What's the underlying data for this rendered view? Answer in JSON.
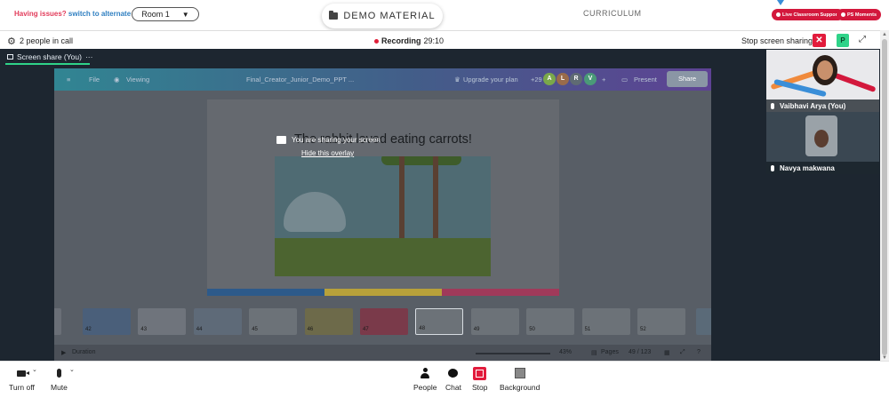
{
  "topbar": {
    "issues_label": "Having issues?",
    "switch_label": "switch to alternate room",
    "room_value": "Room 1",
    "demo_material_label": "DEMO MATERIAL",
    "curriculum_label": "CURRICULUM",
    "live_support_label": "Live Classroom Support",
    "ps_moments_label": "PS Moments",
    "colors": {
      "pill": "#d3183c",
      "issues": "#e23b5a",
      "switch": "#2f7fc1"
    }
  },
  "callbar": {
    "people_in_call": "2 people in call",
    "recording_label": "Recording",
    "recording_time": "29:10",
    "stop_screen_sharing": "Stop screen sharing",
    "close_glyph": "✕",
    "participant_badge": "P",
    "expand_glyph": "⤢"
  },
  "stage": {
    "tab_label": "Screen share (You)",
    "tab_more": "···"
  },
  "shared_screen": {
    "toolbar": {
      "file_label": "File",
      "viewing_label": "Viewing",
      "doc_title": "Final_Creator_Junior_Demo_PPT ...",
      "upgrade_label": "Upgrade your plan",
      "plus_count": "+29",
      "avatars": [
        {
          "letter": "A",
          "color": "#7aa84a"
        },
        {
          "letter": "L",
          "color": "#9a6b4a"
        },
        {
          "letter": "R",
          "color": "#5f6b73"
        },
        {
          "letter": "V",
          "color": "#4a9a78"
        }
      ],
      "add_glyph": "+",
      "present_label": "Present",
      "share_label": "Share"
    },
    "slide": {
      "title": "The rabbit loved eating carrots!",
      "bar_colors": [
        "#2d5a8a",
        "#b8a13a",
        "#a03a5a"
      ]
    },
    "overlay": {
      "message": "You are sharing your screen",
      "hide_link": "Hide this overlay"
    },
    "thumbnails": [
      {
        "num": "",
        "color": "#6a6f77"
      },
      {
        "num": "42",
        "color": "#4a5f7a"
      },
      {
        "num": "43",
        "color": "#6f747c"
      },
      {
        "num": "44",
        "color": "#5e6a78"
      },
      {
        "num": "45",
        "color": "#6c7278"
      },
      {
        "num": "46",
        "color": "#6d6a4a"
      },
      {
        "num": "47",
        "color": "#7a3a4a"
      },
      {
        "num": "48",
        "color": "#6c7278"
      },
      {
        "num": "49",
        "color": "#6c7278"
      },
      {
        "num": "50",
        "color": "#6c7278"
      },
      {
        "num": "51",
        "color": "#6c7278"
      },
      {
        "num": "52",
        "color": "#6c7278"
      },
      {
        "num": "",
        "color": "#5a6a78"
      }
    ],
    "selected_thumb_index": 7,
    "bottom": {
      "duration_label": "Duration",
      "zoom_value": "43%",
      "pages_label": "Pages",
      "page_value": "49 / 123",
      "help_glyph": "?"
    }
  },
  "participants": [
    {
      "name": "Vaibhavi Arya (You)"
    },
    {
      "name": "Navya makwana"
    }
  ],
  "bottombar": {
    "turn_off_label": "Turn off",
    "mute_label": "Mute",
    "people_label": "People",
    "chat_label": "Chat",
    "stop_label": "Stop",
    "background_label": "Background",
    "caret_glyph": "⌄"
  }
}
